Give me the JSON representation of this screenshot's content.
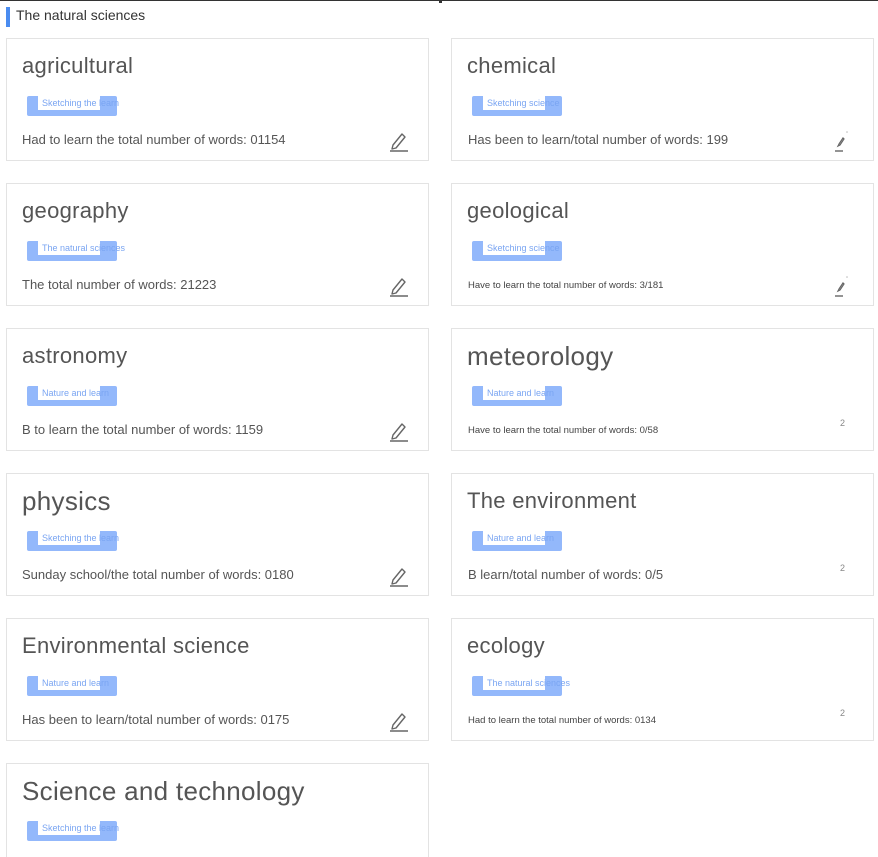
{
  "section": {
    "title": "The natural sciences"
  },
  "cards": [
    {
      "title": "agricultural",
      "tag": "Sketching the learn",
      "info": "Had to learn the total number of words: 01154",
      "action": "pencil-icon"
    },
    {
      "title": "chemical",
      "tag": "Sketching science",
      "info": "Has been to learn/total number of words: 199",
      "action": "pencil-icon"
    },
    {
      "title": "geography",
      "tag": "The natural sciences",
      "info": "The total number of words: 21223",
      "action": "pencil-icon"
    },
    {
      "title": "geological",
      "tag": "Sketching science",
      "info": "Have to learn the total number of words: 3/181",
      "action": "pencil-icon"
    },
    {
      "title": "astronomy",
      "tag": "Nature and learn",
      "info": "B to learn the total number of words: 1159",
      "action": "pencil-icon"
    },
    {
      "title": "meteorology",
      "tag": "Nature and learn",
      "info": "Have to learn the total number of words: 0/58",
      "number": "2"
    },
    {
      "title": "physics",
      "tag": "Sketching the learn",
      "info": "Sunday school/the total number of words: 0180",
      "action": "pencil-icon"
    },
    {
      "title": "The environment",
      "tag": "Nature and learn",
      "info": "B learn/total number of words: 0/5",
      "number": "2"
    },
    {
      "title": "Environmental science",
      "tag": "Nature and learn",
      "info": "Has been to learn/total number of words: 0175",
      "action": "pencil-icon"
    },
    {
      "title": "ecology",
      "tag": "The natural sciences",
      "info": "Had to learn the total number of words: 0134",
      "number": "2"
    },
    {
      "title": "Science and technology",
      "tag": "Sketching the learn",
      "info": ""
    }
  ]
}
